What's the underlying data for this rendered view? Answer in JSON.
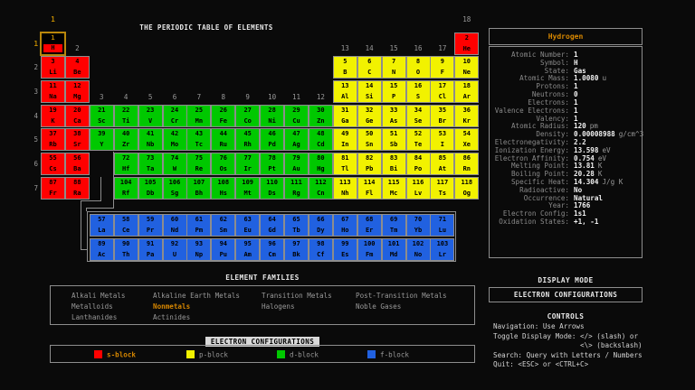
{
  "terminal": {
    "title": "THE PERIODIC TABLE OF ELEMENTS"
  },
  "colors": {
    "s_block": "#ff0000",
    "p_block": "#f2f200",
    "d_block": "#00c800",
    "f_block": "#2161e0",
    "highlight": "#d78700",
    "selection_border": "#b8860b",
    "grid": "#8d8d8d"
  },
  "table": {
    "selected_atomic_number": 1,
    "period_labels": [
      {
        "label": "1",
        "period": 1,
        "highlighted": true
      },
      {
        "label": "2",
        "period": 2,
        "highlighted": false
      },
      {
        "label": "3",
        "period": 3,
        "highlighted": false
      },
      {
        "label": "4",
        "period": 4,
        "highlighted": false
      },
      {
        "label": "5",
        "period": 5,
        "highlighted": false
      },
      {
        "label": "6",
        "period": 6,
        "highlighted": false
      },
      {
        "label": "7",
        "period": 7,
        "highlighted": false
      }
    ],
    "group_labels": [
      {
        "label": "1",
        "group": 1,
        "above_period": 1,
        "highlighted": true
      },
      {
        "label": "2",
        "group": 2,
        "above_period": 2,
        "highlighted": false
      },
      {
        "label": "3",
        "group": 3,
        "above_period": 4,
        "highlighted": false
      },
      {
        "label": "4",
        "group": 4,
        "above_period": 4,
        "highlighted": false
      },
      {
        "label": "5",
        "group": 5,
        "above_period": 4,
        "highlighted": false
      },
      {
        "label": "6",
        "group": 6,
        "above_period": 4,
        "highlighted": false
      },
      {
        "label": "7",
        "group": 7,
        "above_period": 4,
        "highlighted": false
      },
      {
        "label": "8",
        "group": 8,
        "above_period": 4,
        "highlighted": false
      },
      {
        "label": "9",
        "group": 9,
        "above_period": 4,
        "highlighted": false
      },
      {
        "label": "10",
        "group": 10,
        "above_period": 4,
        "highlighted": false
      },
      {
        "label": "11",
        "group": 11,
        "above_period": 4,
        "highlighted": false
      },
      {
        "label": "12",
        "group": 12,
        "above_period": 4,
        "highlighted": false
      },
      {
        "label": "13",
        "group": 13,
        "above_period": 2,
        "highlighted": false
      },
      {
        "label": "14",
        "group": 14,
        "above_period": 2,
        "highlighted": false
      },
      {
        "label": "15",
        "group": 15,
        "above_period": 2,
        "highlighted": false
      },
      {
        "label": "16",
        "group": 16,
        "above_period": 2,
        "highlighted": false
      },
      {
        "label": "17",
        "group": 17,
        "above_period": 2,
        "highlighted": false
      },
      {
        "label": "18",
        "group": 18,
        "above_period": 1,
        "highlighted": false
      }
    ],
    "elements": [
      [
        1,
        "H",
        1,
        1,
        "s"
      ],
      [
        2,
        "He",
        1,
        18,
        "s"
      ],
      [
        3,
        "Li",
        2,
        1,
        "s"
      ],
      [
        4,
        "Be",
        2,
        2,
        "s"
      ],
      [
        5,
        "B",
        2,
        13,
        "p"
      ],
      [
        6,
        "C",
        2,
        14,
        "p"
      ],
      [
        7,
        "N",
        2,
        15,
        "p"
      ],
      [
        8,
        "O",
        2,
        16,
        "p"
      ],
      [
        9,
        "F",
        2,
        17,
        "p"
      ],
      [
        10,
        "Ne",
        2,
        18,
        "p"
      ],
      [
        11,
        "Na",
        3,
        1,
        "s"
      ],
      [
        12,
        "Mg",
        3,
        2,
        "s"
      ],
      [
        13,
        "Al",
        3,
        13,
        "p"
      ],
      [
        14,
        "Si",
        3,
        14,
        "p"
      ],
      [
        15,
        "P",
        3,
        15,
        "p"
      ],
      [
        16,
        "S",
        3,
        16,
        "p"
      ],
      [
        17,
        "Cl",
        3,
        17,
        "p"
      ],
      [
        18,
        "Ar",
        3,
        18,
        "p"
      ],
      [
        19,
        "K",
        4,
        1,
        "s"
      ],
      [
        20,
        "Ca",
        4,
        2,
        "s"
      ],
      [
        21,
        "Sc",
        4,
        3,
        "d"
      ],
      [
        22,
        "Ti",
        4,
        4,
        "d"
      ],
      [
        23,
        "V",
        4,
        5,
        "d"
      ],
      [
        24,
        "Cr",
        4,
        6,
        "d"
      ],
      [
        25,
        "Mn",
        4,
        7,
        "d"
      ],
      [
        26,
        "Fe",
        4,
        8,
        "d"
      ],
      [
        27,
        "Co",
        4,
        9,
        "d"
      ],
      [
        28,
        "Ni",
        4,
        10,
        "d"
      ],
      [
        29,
        "Cu",
        4,
        11,
        "d"
      ],
      [
        30,
        "Zn",
        4,
        12,
        "d"
      ],
      [
        31,
        "Ga",
        4,
        13,
        "p"
      ],
      [
        32,
        "Ge",
        4,
        14,
        "p"
      ],
      [
        33,
        "As",
        4,
        15,
        "p"
      ],
      [
        34,
        "Se",
        4,
        16,
        "p"
      ],
      [
        35,
        "Br",
        4,
        17,
        "p"
      ],
      [
        36,
        "Kr",
        4,
        18,
        "p"
      ],
      [
        37,
        "Rb",
        5,
        1,
        "s"
      ],
      [
        38,
        "Sr",
        5,
        2,
        "s"
      ],
      [
        39,
        "Y",
        5,
        3,
        "d"
      ],
      [
        40,
        "Zr",
        5,
        4,
        "d"
      ],
      [
        41,
        "Nb",
        5,
        5,
        "d"
      ],
      [
        42,
        "Mo",
        5,
        6,
        "d"
      ],
      [
        43,
        "Tc",
        5,
        7,
        "d"
      ],
      [
        44,
        "Ru",
        5,
        8,
        "d"
      ],
      [
        45,
        "Rh",
        5,
        9,
        "d"
      ],
      [
        46,
        "Pd",
        5,
        10,
        "d"
      ],
      [
        47,
        "Ag",
        5,
        11,
        "d"
      ],
      [
        48,
        "Cd",
        5,
        12,
        "d"
      ],
      [
        49,
        "In",
        5,
        13,
        "p"
      ],
      [
        50,
        "Sn",
        5,
        14,
        "p"
      ],
      [
        51,
        "Sb",
        5,
        15,
        "p"
      ],
      [
        52,
        "Te",
        5,
        16,
        "p"
      ],
      [
        53,
        "I",
        5,
        17,
        "p"
      ],
      [
        54,
        "Xe",
        5,
        18,
        "p"
      ],
      [
        55,
        "Cs",
        6,
        1,
        "s"
      ],
      [
        56,
        "Ba",
        6,
        2,
        "s"
      ],
      [
        72,
        "Hf",
        6,
        4,
        "d"
      ],
      [
        73,
        "Ta",
        6,
        5,
        "d"
      ],
      [
        74,
        "W",
        6,
        6,
        "d"
      ],
      [
        75,
        "Re",
        6,
        7,
        "d"
      ],
      [
        76,
        "Os",
        6,
        8,
        "d"
      ],
      [
        77,
        "Ir",
        6,
        9,
        "d"
      ],
      [
        78,
        "Pt",
        6,
        10,
        "d"
      ],
      [
        79,
        "Au",
        6,
        11,
        "d"
      ],
      [
        80,
        "Hg",
        6,
        12,
        "d"
      ],
      [
        81,
        "Tl",
        6,
        13,
        "p"
      ],
      [
        82,
        "Pb",
        6,
        14,
        "p"
      ],
      [
        83,
        "Bi",
        6,
        15,
        "p"
      ],
      [
        84,
        "Po",
        6,
        16,
        "p"
      ],
      [
        85,
        "At",
        6,
        17,
        "p"
      ],
      [
        86,
        "Rn",
        6,
        18,
        "p"
      ],
      [
        87,
        "Fr",
        7,
        1,
        "s"
      ],
      [
        88,
        "Ra",
        7,
        2,
        "s"
      ],
      [
        104,
        "Rf",
        7,
        4,
        "d"
      ],
      [
        105,
        "Db",
        7,
        5,
        "d"
      ],
      [
        106,
        "Sg",
        7,
        6,
        "d"
      ],
      [
        107,
        "Bh",
        7,
        7,
        "d"
      ],
      [
        108,
        "Hs",
        7,
        8,
        "d"
      ],
      [
        109,
        "Mt",
        7,
        9,
        "d"
      ],
      [
        110,
        "Ds",
        7,
        10,
        "d"
      ],
      [
        111,
        "Rg",
        7,
        11,
        "d"
      ],
      [
        112,
        "Cn",
        7,
        12,
        "d"
      ],
      [
        113,
        "Nh",
        7,
        13,
        "p"
      ],
      [
        114,
        "Fl",
        7,
        14,
        "p"
      ],
      [
        115,
        "Mc",
        7,
        15,
        "p"
      ],
      [
        116,
        "Lv",
        7,
        16,
        "p"
      ],
      [
        117,
        "Ts",
        7,
        17,
        "p"
      ],
      [
        118,
        "Og",
        7,
        18,
        "p"
      ],
      [
        57,
        "La",
        8,
        3,
        "f"
      ],
      [
        58,
        "Ce",
        8,
        4,
        "f"
      ],
      [
        59,
        "Pr",
        8,
        5,
        "f"
      ],
      [
        60,
        "Nd",
        8,
        6,
        "f"
      ],
      [
        61,
        "Pm",
        8,
        7,
        "f"
      ],
      [
        62,
        "Sm",
        8,
        8,
        "f"
      ],
      [
        63,
        "Eu",
        8,
        9,
        "f"
      ],
      [
        64,
        "Gd",
        8,
        10,
        "f"
      ],
      [
        65,
        "Tb",
        8,
        11,
        "f"
      ],
      [
        66,
        "Dy",
        8,
        12,
        "f"
      ],
      [
        67,
        "Ho",
        8,
        13,
        "f"
      ],
      [
        68,
        "Er",
        8,
        14,
        "f"
      ],
      [
        69,
        "Tm",
        8,
        15,
        "f"
      ],
      [
        70,
        "Yb",
        8,
        16,
        "f"
      ],
      [
        71,
        "Lu",
        8,
        17,
        "f"
      ],
      [
        89,
        "Ac",
        9,
        3,
        "f"
      ],
      [
        90,
        "Th",
        9,
        4,
        "f"
      ],
      [
        91,
        "Pa",
        9,
        5,
        "f"
      ],
      [
        92,
        "U",
        9,
        6,
        "f"
      ],
      [
        93,
        "Np",
        9,
        7,
        "f"
      ],
      [
        94,
        "Pu",
        9,
        8,
        "f"
      ],
      [
        95,
        "Am",
        9,
        9,
        "f"
      ],
      [
        96,
        "Cm",
        9,
        10,
        "f"
      ],
      [
        97,
        "Bk",
        9,
        11,
        "f"
      ],
      [
        98,
        "Cf",
        9,
        12,
        "f"
      ],
      [
        99,
        "Es",
        9,
        13,
        "f"
      ],
      [
        100,
        "Fm",
        9,
        14,
        "f"
      ],
      [
        101,
        "Md",
        9,
        15,
        "f"
      ],
      [
        102,
        "No",
        9,
        16,
        "f"
      ],
      [
        103,
        "Lr",
        9,
        17,
        "f"
      ]
    ]
  },
  "element_families": {
    "heading": "ELEMENT FAMILIES",
    "items": [
      {
        "label": "Alkali Metals",
        "row": 0,
        "col": 0,
        "highlighted": false
      },
      {
        "label": "Alkaline Earth Metals",
        "row": 0,
        "col": 1,
        "highlighted": false
      },
      {
        "label": "Transition Metals",
        "row": 0,
        "col": 2,
        "highlighted": false
      },
      {
        "label": "Post-Transition Metals",
        "row": 0,
        "col": 3,
        "highlighted": false
      },
      {
        "label": "Metalloids",
        "row": 1,
        "col": 0,
        "highlighted": false
      },
      {
        "label": "Nonmetals",
        "row": 1,
        "col": 1,
        "highlighted": true
      },
      {
        "label": "Halogens",
        "row": 1,
        "col": 2,
        "highlighted": false
      },
      {
        "label": "Noble Gases",
        "row": 1,
        "col": 3,
        "highlighted": false
      },
      {
        "label": "Lanthanides",
        "row": 2,
        "col": 0,
        "highlighted": false
      },
      {
        "label": "Actinides",
        "row": 2,
        "col": 1,
        "highlighted": false
      }
    ]
  },
  "electron_config_legend": {
    "heading": "ELECTRON CONFIGURATIONS",
    "items": [
      {
        "label": "s-block",
        "color": "#ff0000",
        "highlighted": true
      },
      {
        "label": "p-block",
        "color": "#f2f200",
        "highlighted": false
      },
      {
        "label": "d-block",
        "color": "#00c800",
        "highlighted": false
      },
      {
        "label": "f-block",
        "color": "#2161e0",
        "highlighted": false
      }
    ]
  },
  "details_panel": {
    "title": "Hydrogen",
    "rows": [
      {
        "label": "Atomic Number:",
        "value": "1",
        "unit": ""
      },
      {
        "label": "Symbol:",
        "value": "H",
        "unit": ""
      },
      {
        "label": "State:",
        "value": "Gas",
        "unit": ""
      },
      {
        "label": "Atomic Mass:",
        "value": "1.0080",
        "unit": "u"
      },
      {
        "label": "Protons:",
        "value": "1",
        "unit": ""
      },
      {
        "label": "Neutrons:",
        "value": "0",
        "unit": ""
      },
      {
        "label": "Electrons:",
        "value": "1",
        "unit": ""
      },
      {
        "label": "Valence Electrons:",
        "value": "1",
        "unit": ""
      },
      {
        "label": "Valency:",
        "value": "1",
        "unit": ""
      },
      {
        "label": "Atomic Radius:",
        "value": "120",
        "unit": "pm"
      },
      {
        "label": "Density:",
        "value": "0.00008988",
        "unit": "g/cm^3"
      },
      {
        "label": "Electronegativity:",
        "value": "2.2",
        "unit": ""
      },
      {
        "label": "Ionization Energy:",
        "value": "13.598",
        "unit": "eV"
      },
      {
        "label": "Electron Affinity:",
        "value": "0.754",
        "unit": "eV"
      },
      {
        "label": "Melting Point:",
        "value": "13.81",
        "unit": "K"
      },
      {
        "label": "Boiling Point:",
        "value": "20.28",
        "unit": "K"
      },
      {
        "label": "Specific Heat:",
        "value": "14.304",
        "unit": "J/g K"
      },
      {
        "label": "Radioactive:",
        "value": "No",
        "unit": ""
      },
      {
        "label": "Occurrence:",
        "value": "Natural",
        "unit": ""
      },
      {
        "label": "Year:",
        "value": "1766",
        "unit": ""
      },
      {
        "label": "Electron Config:",
        "value": "1s1",
        "unit": ""
      },
      {
        "label": "Oxidation States:",
        "value": "+1, -1",
        "unit": ""
      }
    ]
  },
  "display_mode": {
    "heading": "DISPLAY MODE",
    "value": "ELECTRON CONFIGURATIONS"
  },
  "controls": {
    "heading": "CONTROLS",
    "lines": [
      "Navigation: Use Arrows",
      "Toggle Display Mode: </> (slash) or",
      "                     <\\> (backslash)",
      "Search: Query with Letters / Numbers",
      "Quit: <ESC> or <CTRL+C>"
    ]
  }
}
